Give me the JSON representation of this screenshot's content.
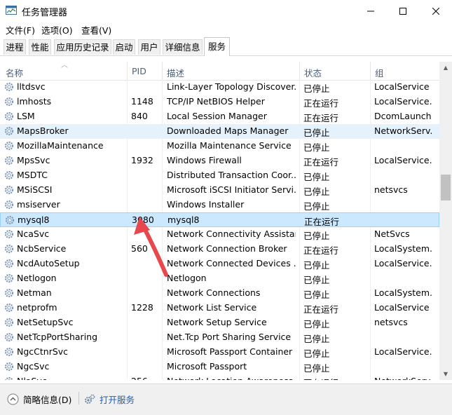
{
  "window": {
    "title": "任务管理器"
  },
  "menu": [
    "文件(F)",
    "选项(O)",
    "查看(V)"
  ],
  "tabs": [
    "进程",
    "性能",
    "应用历史记录",
    "启动",
    "用户",
    "详细信息",
    "服务"
  ],
  "active_tab": "服务",
  "columns": {
    "name": "名称",
    "pid": "PID",
    "desc": "描述",
    "status": "状态",
    "group": "组"
  },
  "rows": [
    {
      "name": "lltdsvc",
      "pid": "",
      "desc": "Link-Layer Topology Discover...",
      "status": "已停止",
      "group": "LocalService"
    },
    {
      "name": "lmhosts",
      "pid": "1148",
      "desc": "TCP/IP NetBIOS Helper",
      "status": "正在运行",
      "group": "LocalService..."
    },
    {
      "name": "LSM",
      "pid": "840",
      "desc": "Local Session Manager",
      "status": "正在运行",
      "group": "DcomLaunch"
    },
    {
      "name": "MapsBroker",
      "pid": "",
      "desc": "Downloaded Maps Manager",
      "status": "已停止",
      "group": "NetworkServ..."
    },
    {
      "name": "MozillaMaintenance",
      "pid": "",
      "desc": "Mozilla Maintenance Service",
      "status": "已停止",
      "group": ""
    },
    {
      "name": "MpsSvc",
      "pid": "1932",
      "desc": "Windows Firewall",
      "status": "正在运行",
      "group": "LocalService..."
    },
    {
      "name": "MSDTC",
      "pid": "",
      "desc": "Distributed Transaction Coor...",
      "status": "已停止",
      "group": ""
    },
    {
      "name": "MSiSCSI",
      "pid": "",
      "desc": "Microsoft iSCSI Initiator Servi...",
      "status": "已停止",
      "group": "netsvcs"
    },
    {
      "name": "msiserver",
      "pid": "",
      "desc": "Windows Installer",
      "status": "已停止",
      "group": ""
    },
    {
      "name": "mysql8",
      "pid": "3080",
      "desc": "mysql8",
      "status": "正在运行",
      "group": ""
    },
    {
      "name": "NcaSvc",
      "pid": "",
      "desc": "Network Connectivity Assistant",
      "status": "已停止",
      "group": "NetSvcs"
    },
    {
      "name": "NcbService",
      "pid": "560",
      "desc": "Network Connection Broker",
      "status": "正在运行",
      "group": "LocalSystem..."
    },
    {
      "name": "NcdAutoSetup",
      "pid": "",
      "desc": "Network Connected Devices ...",
      "status": "已停止",
      "group": "LocalService..."
    },
    {
      "name": "Netlogon",
      "pid": "",
      "desc": "Netlogon",
      "status": "已停止",
      "group": ""
    },
    {
      "name": "Netman",
      "pid": "",
      "desc": "Network Connections",
      "status": "已停止",
      "group": "LocalSystem..."
    },
    {
      "name": "netprofm",
      "pid": "1228",
      "desc": "Network List Service",
      "status": "正在运行",
      "group": "LocalService"
    },
    {
      "name": "NetSetupSvc",
      "pid": "",
      "desc": "Network Setup Service",
      "status": "已停止",
      "group": "netsvcs"
    },
    {
      "name": "NetTcpPortSharing",
      "pid": "",
      "desc": "Net.Tcp Port Sharing Service",
      "status": "已停止",
      "group": ""
    },
    {
      "name": "NgcCtnrSvc",
      "pid": "",
      "desc": "Microsoft Passport Container",
      "status": "已停止",
      "group": "LocalService..."
    },
    {
      "name": "NgcSvc",
      "pid": "",
      "desc": "Microsoft Passport",
      "status": "已停止",
      "group": ""
    },
    {
      "name": "NlaSvc",
      "pid": "256",
      "desc": "Network Location Awareness",
      "status": "正在运行",
      "group": "NetworkServ..."
    }
  ],
  "hover_row_index": 3,
  "selected_row_index": 9,
  "footer": {
    "details": "简略信息(D)",
    "open_services": "打开服务"
  },
  "annotation": {
    "color": "#e8474e"
  }
}
